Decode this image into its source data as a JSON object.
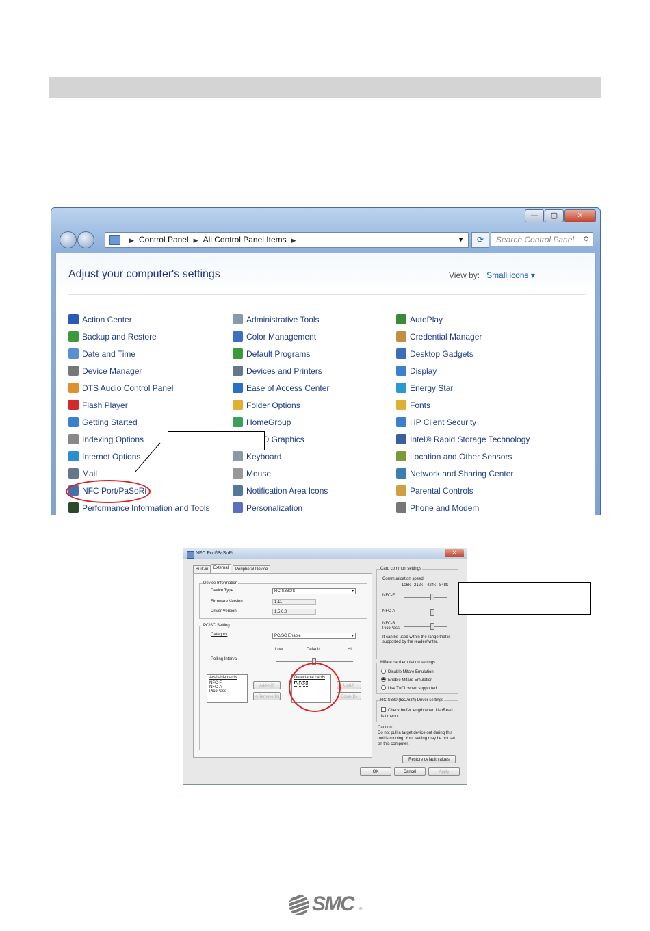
{
  "window": {
    "caption_buttons": {
      "minimize": "—",
      "maximize": "▢",
      "close": "✕"
    },
    "breadcrumb": [
      "Control Panel",
      "All Control Panel Items"
    ],
    "search_placeholder": "Search Control Panel",
    "heading": "Adjust your computer's settings",
    "view_by_label": "View by:",
    "view_by_value": "Small icons"
  },
  "items": {
    "col1": [
      "Action Center",
      "Backup and Restore",
      "Date and Time",
      "Device Manager",
      "DTS Audio Control Panel",
      "Flash Player",
      "Getting Started",
      "Indexing Options",
      "Internet Options",
      "Mail",
      "NFC Port/PaSoRi",
      "Performance Information and Tools"
    ],
    "col2": [
      "Administrative Tools",
      "Color Management",
      "Default Programs",
      "Devices and Printers",
      "Ease of Access Center",
      "Folder Options",
      "HomeGroup",
      "R) HD Graphics",
      "Keyboard",
      "Mouse",
      "Notification Area Icons",
      "Personalization"
    ],
    "col3": [
      "AutoPlay",
      "Credential Manager",
      "Desktop Gadgets",
      "Display",
      "Energy Star",
      "Fonts",
      "HP Client Security",
      "Intel® Rapid Storage Technology",
      "Location and Other Sensors",
      "Network and Sharing Center",
      "Parental Controls",
      "Phone and Modem"
    ]
  },
  "icon_colors": {
    "col1": [
      "#2a59b8",
      "#3c9a3c",
      "#5a8fd0",
      "#777777",
      "#e09030",
      "#d02a2a",
      "#3a7fd0",
      "#888888",
      "#2a8fd0",
      "#667788",
      "#4a6fa8",
      "#2b4a2b"
    ],
    "col2": [
      "#889aa8",
      "#3b6fc0",
      "#3a9a3a",
      "#667788",
      "#2a6fc0",
      "#e0b030",
      "#3aa05a",
      "#c03030",
      "#8899aa",
      "#999999",
      "#557799",
      "#5a6fc0"
    ],
    "col3": [
      "#3a8a3a",
      "#c09040",
      "#3a6fb8",
      "#3a7fd0",
      "#2a9ad0",
      "#e0b030",
      "#3a7fd0",
      "#3a5fa0",
      "#7a9a3a",
      "#3a7fb0",
      "#d0a040",
      "#777777"
    ]
  },
  "dialog": {
    "title": "NFC Port/PaSoRi",
    "close": "✕",
    "tabs": [
      "Built-in",
      "External",
      "Peripheral Device"
    ],
    "device_info": {
      "legend": "Device Information",
      "device_type_label": "Device Type",
      "device_type_value": "RC-S380/S",
      "firmware_label": "Firmware Version",
      "firmware_value": "1.11",
      "driver_label": "Driver Version",
      "driver_value": "1.5.0.0"
    },
    "pcsc": {
      "legend": "PC/SC Setting",
      "category_label": "Category",
      "category_value": "PC/SC Enable",
      "low": "Low",
      "default": "Default",
      "high": "Hi",
      "polling_label": "Polling Interval",
      "available_label": "Available cards",
      "available_cards": [
        "NFC-F",
        "NFC-A",
        "PicoPass"
      ],
      "detectable_label": "Detectable cards",
      "detectable_cards": [
        "NFC-B"
      ],
      "add_btn": "Add->(I)",
      "remove_btn": "<-Remove(R)",
      "up_btn": "Up(U)",
      "down_btn": "Down(D)"
    },
    "card_common": {
      "legend": "Card common settings",
      "speed_label": "Communication speed",
      "speeds": [
        "106k",
        "212k",
        "424k",
        "848k"
      ],
      "rows": [
        "NFC-F",
        "NFC-A",
        "NFC-B PicoPass"
      ],
      "note": "It can be used within the range that is supported by the reader/writer."
    },
    "mifare": {
      "legend": "Mifare card emulation settings",
      "options": [
        "Disable Mifare Emulation",
        "Enable Mifare Emulation",
        "Use T=CL when supported"
      ]
    },
    "driver": {
      "legend": "RC-S380 (632/634) Driver settings",
      "check": "Check buffer length when UsbRead is timeout"
    },
    "caution_title": "Caution:",
    "caution_text": "Do not pull a target device out during this tool is running. Your setting may be not set on this computer.",
    "restore_btn": "Restore default values",
    "ok_btn": "OK",
    "cancel_btn": "Cancel",
    "apply_btn": "Apply"
  },
  "logo": {
    "text": "SMC",
    "registered": "®"
  }
}
